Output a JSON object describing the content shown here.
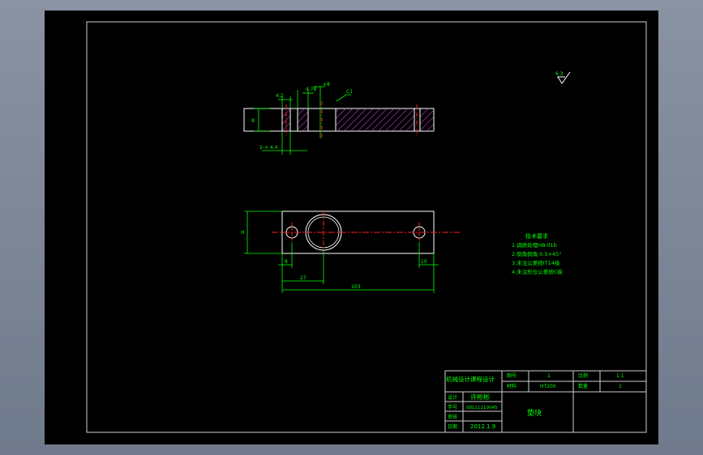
{
  "surface_finish": {
    "value": "6.3"
  },
  "dimensions": {
    "top_a": "4.2",
    "top_b": "4.78",
    "top_c": "×8",
    "top_c1": "C1",
    "top_height": "8",
    "bottom_holes": "2-× 4.4",
    "width_h": "H",
    "left_8": "8",
    "right_10": "10",
    "inner_27": "27",
    "overall_103": "103"
  },
  "tech_requirements": {
    "title": "技术要求",
    "items": [
      "1.调质处理HB-ll1ḃ",
      "2.倒角倒角 0.5×45°",
      "3.未注公差按IT14级",
      "4.未注形位公差按C级"
    ]
  },
  "title_block": {
    "design_title": "机械设计课程设计",
    "row_label_1": "图号",
    "row_value_1": "1",
    "row_label_2": "材料",
    "row_value_2": "HT200",
    "scale_label": "比例",
    "scale_value": "1:1",
    "qty_label": "数量",
    "qty_value": "1",
    "designer_label": "设计",
    "designer_value": "许彬彬",
    "student_id_label": "学号",
    "student_id_value": "08111110045",
    "check_label": "审核",
    "date_label": "日期",
    "date_value": "2012.1.9",
    "part_name": "垫块"
  },
  "colors": {
    "background": "#000000",
    "outline": "#ffffff",
    "dimension": "#00ff00",
    "centerline": "#ff2020",
    "hatch": "#c040d0",
    "frame": "#cfcfcf"
  }
}
